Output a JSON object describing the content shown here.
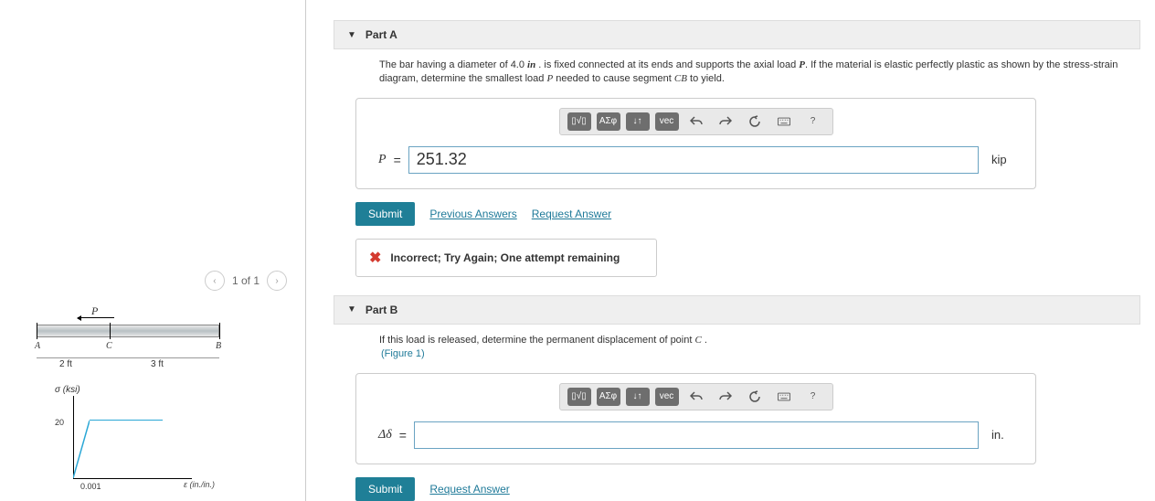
{
  "pager": {
    "label": "1 of 1"
  },
  "figure": {
    "p": "P",
    "A": "A",
    "B": "B",
    "C": "C",
    "dim1": "2 ft",
    "dim2": "3 ft"
  },
  "chart_data": {
    "type": "line",
    "title": "",
    "xlabel": "ε (in./in.)",
    "ylabel": "σ (ksi)",
    "x": [
      0,
      0.001,
      0.007
    ],
    "values": [
      0,
      20,
      20
    ],
    "x_ticks": [
      "0.001"
    ],
    "y_ticks": [
      "20"
    ],
    "xlim": [
      0,
      0.008
    ],
    "ylim": [
      0,
      28
    ]
  },
  "partA": {
    "title": "Part A",
    "prompt_pre": "The bar having a diameter of 4.0 ",
    "prompt_unit": "in",
    "prompt_mid1": " . is fixed connected at its ends and supports the axial load ",
    "prompt_P": "P",
    "prompt_mid2": ". If the material is elastic perfectly plastic as shown by the stress-strain diagram, determine the smallest load ",
    "prompt_Pi": "P",
    "prompt_end": " needed to cause segment ",
    "prompt_CB": "CB",
    "prompt_tail": " to yield.",
    "var": "P",
    "equals": "=",
    "value": "251.32",
    "unit": "kip",
    "submit": "Submit",
    "prev": "Previous Answers",
    "req": "Request Answer",
    "feedback": "Incorrect; Try Again; One attempt remaining"
  },
  "partB": {
    "title": "Part B",
    "prompt": "If this load is released, determine the permanent displacement of point ",
    "prompt_C": "C",
    "prompt_tail": " .",
    "fig_link": "(Figure 1)",
    "var": "Δδ",
    "equals": "=",
    "value": "",
    "unit": "in.",
    "submit": "Submit",
    "req": "Request Answer"
  },
  "toolbar": {
    "templates": "▯√▯",
    "greek": "ΑΣφ",
    "updown": "↓↑",
    "vec": "vec",
    "help": "?"
  }
}
